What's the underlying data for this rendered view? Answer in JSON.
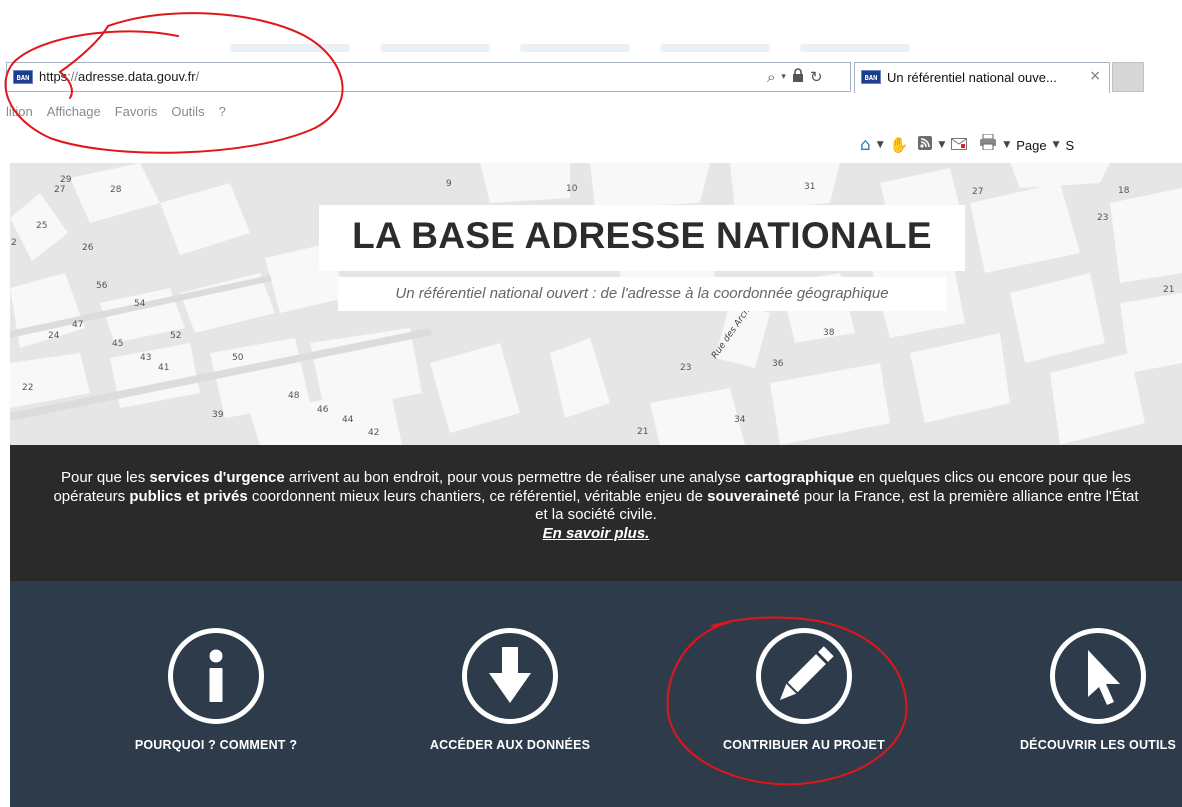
{
  "browser": {
    "url_scheme": "https",
    "url_separator": "://",
    "url_domain": "adresse.data.gouv.fr",
    "url_path": "/",
    "favicon_text": "BAN",
    "tab_title": "Un référentiel national ouve...",
    "tab_close": "×",
    "menu": [
      "lition",
      "Affichage",
      "Favoris",
      "Outils",
      "?"
    ],
    "page_menu": "Page",
    "page_menu_cut": "S",
    "icons": [
      "search-icon",
      "lock-icon",
      "refresh-icon",
      "home-icon",
      "hand-icon",
      "rss-icon",
      "mail-icon",
      "print-icon"
    ]
  },
  "hero": {
    "title": "LA BASE ADRESSE NATIONALE",
    "subtitle": "Un référentiel national ouvert : de l'adresse à la coordonnée géographique",
    "street_label": "Rue des Archives",
    "house_numbers": [
      "29",
      "27",
      "28",
      "25",
      "26",
      "2",
      "56",
      "54",
      "47",
      "24",
      "52",
      "45",
      "43",
      "41",
      "50",
      "22",
      "39",
      "48",
      "46",
      "44",
      "42",
      "9",
      "10",
      "31",
      "27",
      "18",
      "23",
      "21",
      "38",
      "36",
      "23",
      "34",
      "21"
    ]
  },
  "intro": {
    "t1": "Pour que les ",
    "b1": "services d'urgence",
    "t2": " arrivent au bon endroit, pour vous permettre de réaliser une analyse ",
    "b2": "cartographique",
    "t3": " en quelques clics ou encore pour que les opérateurs ",
    "b3": "publics et privés",
    "t4": " coordonnent mieux leurs chantiers, ce référentiel, véritable enjeu de ",
    "b4": "souveraineté",
    "t5": " pour la France, est la première alliance entre l'État et la société civile.",
    "link": "En savoir plus."
  },
  "features": [
    {
      "label": "POURQUOI ? COMMENT ?",
      "icon": "info-icon"
    },
    {
      "label": "ACCÉDER AUX DONNÉES",
      "icon": "download-icon"
    },
    {
      "label": "CONTRIBUER AU PROJET",
      "icon": "pencil-icon"
    },
    {
      "label": "DÉCOUVRIR LES OUTILS",
      "icon": "cursor-icon"
    }
  ],
  "colors": {
    "intro_bg": "#2a2a2a",
    "features_bg": "#2d3b4b",
    "map_bg": "#e6e6e6",
    "annotation": "#e0161b"
  }
}
